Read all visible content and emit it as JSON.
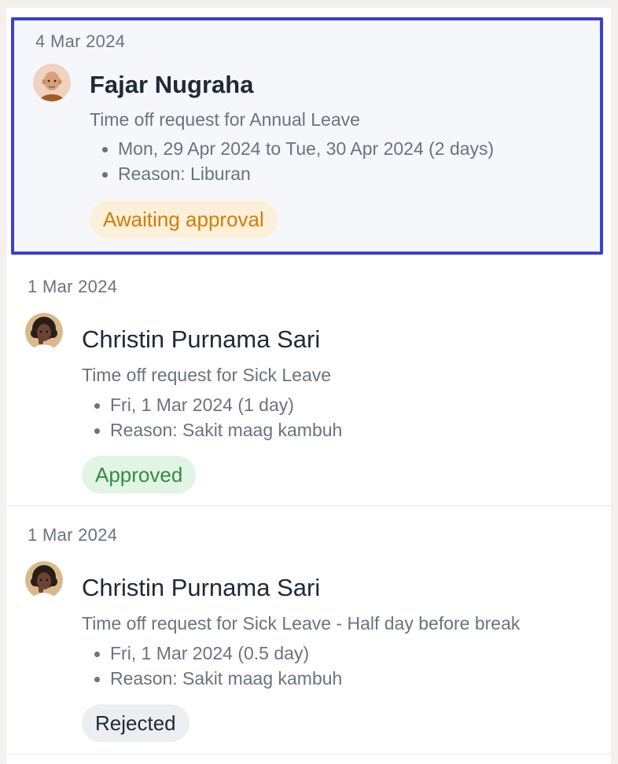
{
  "requests": [
    {
      "date": "4 Mar 2024",
      "name": "Fajar Nugraha",
      "subtitle": "Time off request for Annual Leave",
      "details": [
        "Mon, 29 Apr 2024 to Tue, 30 Apr 2024 (2 days)",
        "Reason: Liburan"
      ],
      "status": "Awaiting approval",
      "avatar_icon": "memoji-bald-man-avatar",
      "selected": true
    },
    {
      "date": "1 Mar 2024",
      "name": "Christin Purnama Sari",
      "subtitle": "Time off request for Sick Leave",
      "details": [
        "Fri, 1 Mar 2024 (1 day)",
        "Reason: Sakit maag kambuh"
      ],
      "status": "Approved",
      "avatar_icon": "memoji-curly-hair-woman-avatar",
      "selected": false
    },
    {
      "date": "1 Mar 2024",
      "name": "Christin Purnama Sari",
      "subtitle": "Time off request for Sick Leave - Half day before break",
      "details": [
        "Fri, 1 Mar 2024 (0.5 day)",
        "Reason: Sakit maag kambuh"
      ],
      "status": "Rejected",
      "avatar_icon": "memoji-curly-hair-woman-avatar",
      "selected": false
    }
  ],
  "colors": {
    "selection_border": "#3b3fd1",
    "awaiting_bg": "#fdf0d8",
    "awaiting_text": "#d77a09",
    "approved_bg": "#e2f4e4",
    "approved_text": "#2f8d43",
    "rejected_bg": "#eceef2",
    "rejected_text": "#1f2937"
  }
}
